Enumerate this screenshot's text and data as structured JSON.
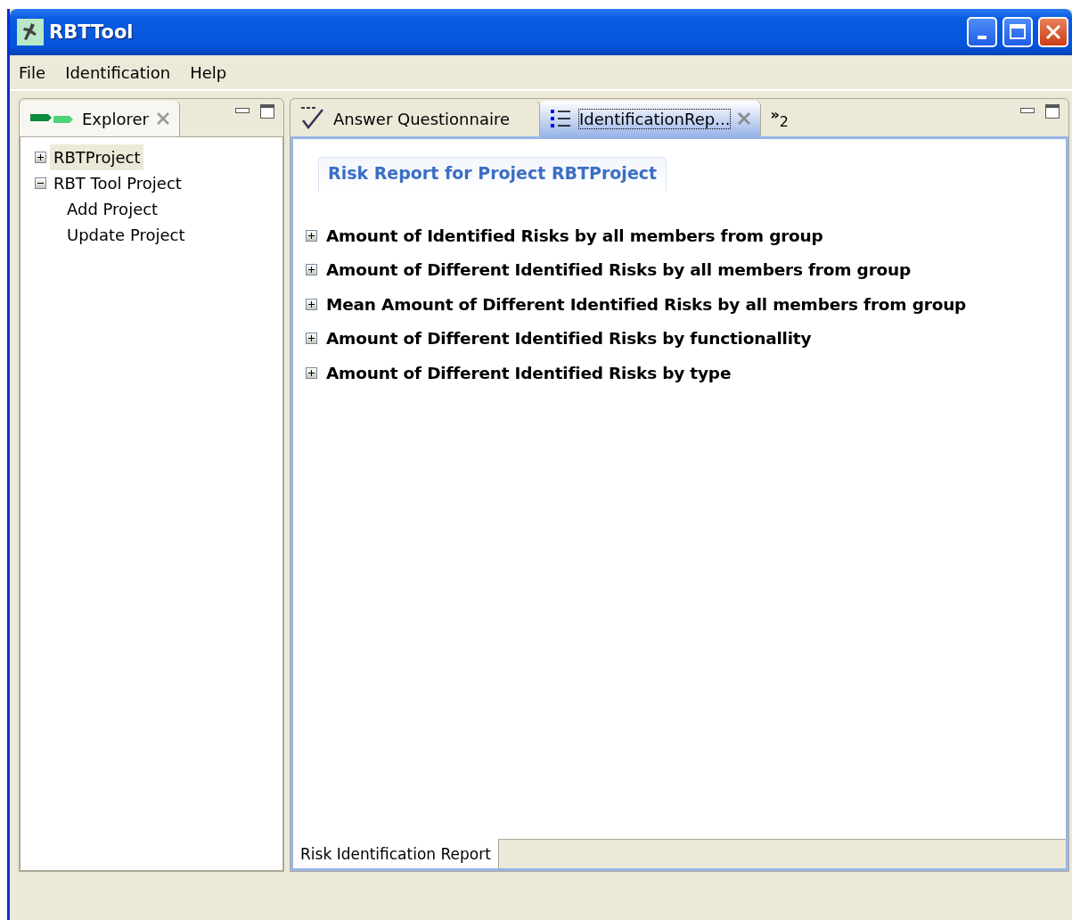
{
  "window": {
    "title": "RBTTool"
  },
  "menu": [
    {
      "label": "File"
    },
    {
      "label": "Identification"
    },
    {
      "label": "Help"
    }
  ],
  "explorer": {
    "tab": {
      "label": "Explorer",
      "selected": true
    },
    "tree": [
      {
        "label": "RBTProject",
        "expanded": false,
        "selected": true
      },
      {
        "label": "RBT Tool Project",
        "expanded": true,
        "selected": false,
        "children": [
          {
            "label": "Add Project",
            "selected": false
          },
          {
            "label": "Update Project",
            "selected": false
          }
        ]
      }
    ]
  },
  "editor": {
    "tabs": [
      {
        "label": "Answer Questionnaire",
        "kind": "questionnaire",
        "selected": false,
        "closable": false
      },
      {
        "label": "IdentificationRep...",
        "kind": "report",
        "selected": true,
        "closable": true
      }
    ],
    "overflow": {
      "icon": "»",
      "count": "2"
    },
    "report": {
      "title": "Risk Report for Project RBTProject",
      "sections": [
        {
          "label": "Amount of Identified Risks by all members from group",
          "expanded": false
        },
        {
          "label": "Amount of Different Identified Risks by all members from group",
          "expanded": false
        },
        {
          "label": "Mean Amount of Different Identified Risks by all members from group",
          "expanded": false
        },
        {
          "label": "Amount of Different Identified Risks by functionallity",
          "expanded": false
        },
        {
          "label": "Amount of Different Identified Risks by type",
          "expanded": false
        }
      ]
    },
    "bottom_tabs": [
      {
        "label": "Risk Identification Report",
        "selected": true
      }
    ]
  }
}
